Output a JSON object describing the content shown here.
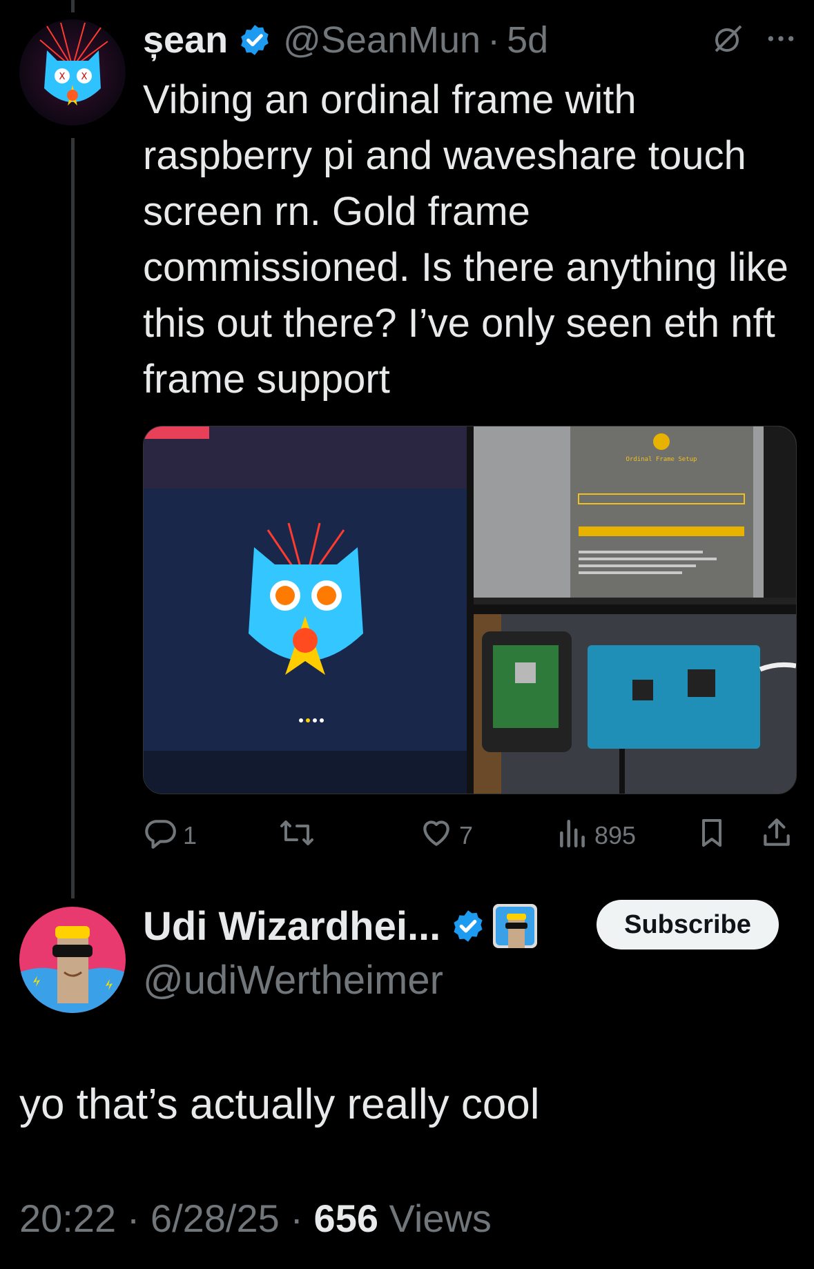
{
  "tweet": {
    "author_name": "șean",
    "author_handle": "@SeanMun",
    "separator": "·",
    "time_ago": "5d",
    "text": "Vibing an ordinal frame with raspberry pi and waveshare touch screen rn. Gold frame commissioned. Is there anything like this out there? I’ve only seen eth nft frame support",
    "stats": {
      "replies": "1",
      "likes": "7",
      "views": "895"
    },
    "icons": [
      "grok-slash-icon",
      "more-icon",
      "reply-icon",
      "retweet-icon",
      "like-icon",
      "views-icon",
      "bookmark-icon",
      "share-icon"
    ],
    "media_screen_title": "Ordinal Frame Setup"
  },
  "reply": {
    "author_name": "Udi Wizardhei...",
    "author_handle": "@udiWertheimer",
    "subscribe_label": "Subscribe",
    "text": "yo that’s actually really cool",
    "time": "20:22",
    "date": "6/28/25",
    "sep": "·",
    "views_count": "656",
    "views_label": "Views"
  },
  "colors": {
    "background": "#000000",
    "text": "#e7e9ea",
    "muted": "#71767b",
    "verified": "#1d9bf0",
    "subscribe_bg": "#eff3f4"
  }
}
